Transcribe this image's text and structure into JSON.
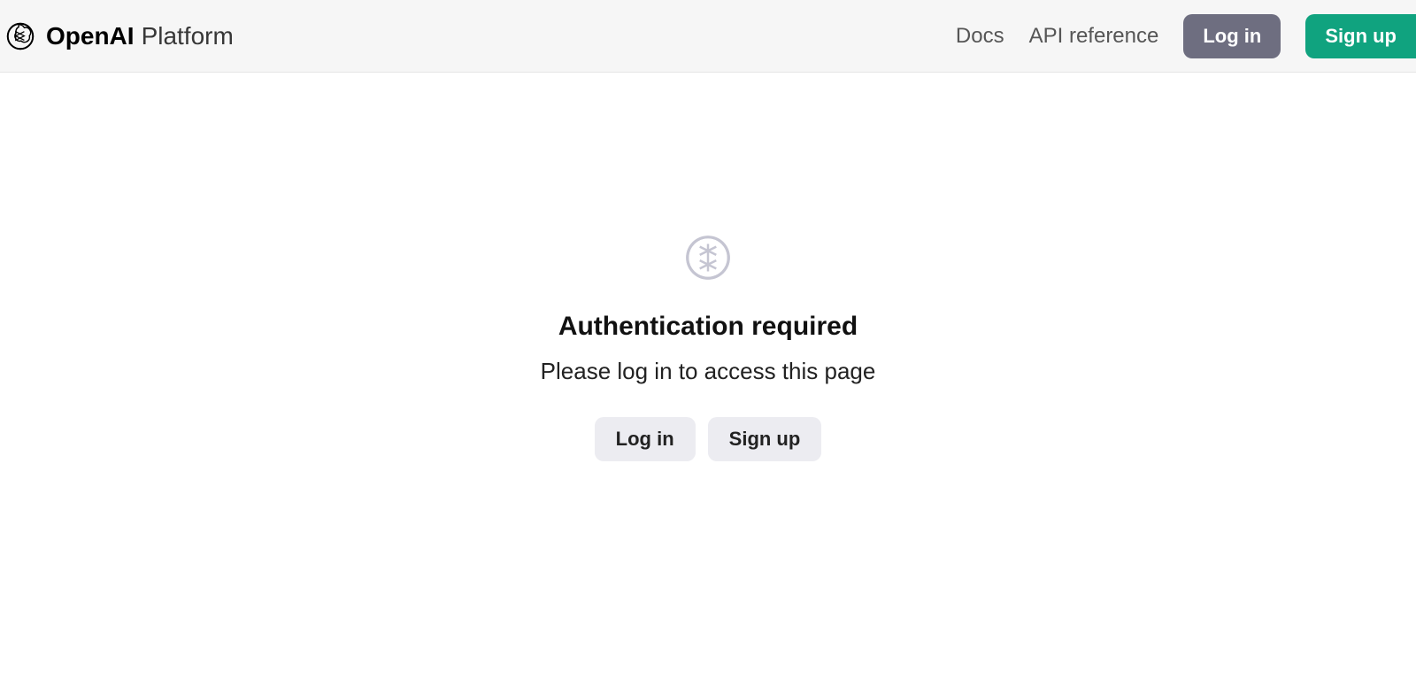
{
  "header": {
    "brand_strong": "OpenAI",
    "brand_light": "Platform",
    "nav": {
      "docs": "Docs",
      "api_reference": "API reference"
    },
    "login_label": "Log in",
    "signup_label": "Sign up"
  },
  "main": {
    "title": "Authentication required",
    "subtitle": "Please log in to access this page",
    "login_label": "Log in",
    "signup_label": "Sign up"
  }
}
